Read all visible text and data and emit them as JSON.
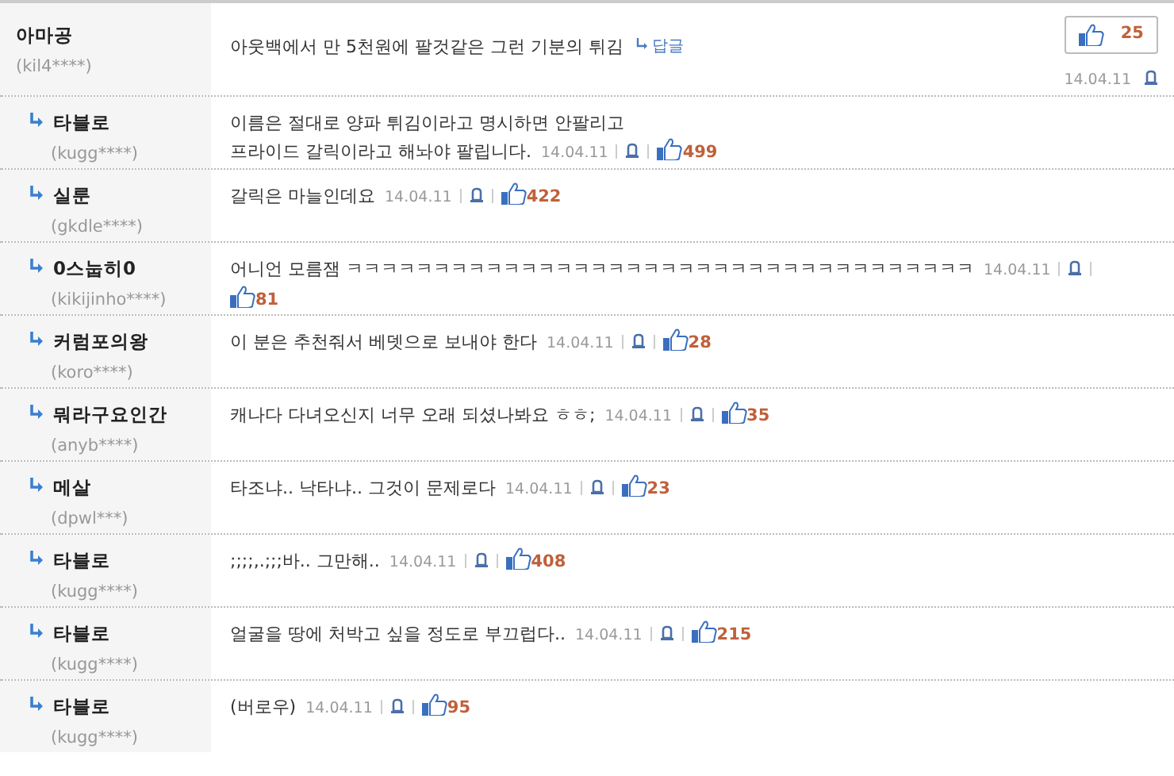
{
  "comment": {
    "author": "아마공",
    "user_id": "(kil4****)",
    "text": "아웃백에서 만 5천원에 팔것같은 그런 기분의 튀김",
    "reply_link": "답글",
    "likes": "25",
    "date": "14.04.11"
  },
  "replies": [
    {
      "author": "타블로",
      "user_id": "(kugg****)",
      "text": "이름은 절대로 양파 튀김이라고 명시하면 안팔리고\n프라이드 갈릭이라고 해놔야 팔립니다.",
      "date": "14.04.11",
      "likes": "499"
    },
    {
      "author": "실룬",
      "user_id": "(gkdle****)",
      "text": "갈릭은 마늘인데요",
      "date": "14.04.11",
      "likes": "422"
    },
    {
      "author": "0스눕히0",
      "user_id": "(kikijinho****)",
      "text": "어니언 모름잼 ㅋㅋㅋㅋㅋㅋㅋㅋㅋㅋㅋㅋㅋㅋㅋㅋㅋㅋㅋㅋㅋㅋㅋㅋㅋㅋㅋㅋㅋㅋㅋㅋㅋㅋㅋㅋ",
      "date": "14.04.11",
      "likes": "81"
    },
    {
      "author": "커럼포의왕",
      "user_id": "(koro****)",
      "text": "이 분은 추천줘서 베뎃으로 보내야 한다",
      "date": "14.04.11",
      "likes": "28"
    },
    {
      "author": "뭐라구요인간",
      "user_id": "(anyb****)",
      "text": "캐나다 다녀오신지 너무 오래 되셨나봐요 ㅎㅎ;",
      "date": "14.04.11",
      "likes": "35"
    },
    {
      "author": "메살",
      "user_id": "(dpwl***)",
      "text": "타조냐.. 낙타냐.. 그것이 문제로다",
      "date": "14.04.11",
      "likes": "23"
    },
    {
      "author": "타블로",
      "user_id": "(kugg****)",
      "text": ";;;;,.;;;바.. 그만해..",
      "date": "14.04.11",
      "likes": "408"
    },
    {
      "author": "타블로",
      "user_id": "(kugg****)",
      "text": "얼굴을 땅에 처박고 싶을 정도로 부끄럽다..",
      "date": "14.04.11",
      "likes": "215"
    },
    {
      "author": "타블로",
      "user_id": "(kugg****)",
      "text": "(버로우)",
      "date": "14.04.11",
      "likes": "95"
    }
  ]
}
